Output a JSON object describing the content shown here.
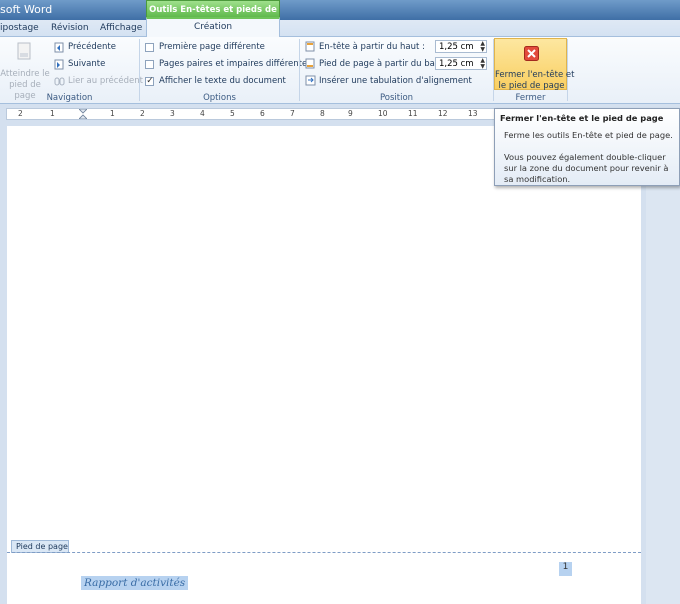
{
  "window": {
    "title": "soft Word"
  },
  "tools_tab": {
    "label": "Outils En-têtes et pieds de page"
  },
  "tabs": [
    {
      "label": "ipostage"
    },
    {
      "label": "Révision"
    },
    {
      "label": "Affichage"
    },
    {
      "label": "Création"
    }
  ],
  "navigation": {
    "goto_label": "Atteindre le pied de page",
    "previous_label": "Précédente",
    "next_label": "Suivante",
    "link_label": "Lier au précédent",
    "group_label": "Navigation"
  },
  "options": {
    "first_page": {
      "label": "Première page différente",
      "checked": false
    },
    "odd_even": {
      "label": "Pages paires et impaires différentes",
      "checked": false
    },
    "show_text": {
      "label": "Afficher le texte du document",
      "checked": true
    },
    "group_label": "Options"
  },
  "position": {
    "header_label": "En-tête à partir du haut :",
    "header_value": "1,25 cm",
    "footer_label": "Pied de page à partir du bas :",
    "footer_value": "1,25 cm",
    "insert_tab_label": "Insérer une tabulation d'alignement",
    "group_label": "Position"
  },
  "close": {
    "label_line1": "Fermer l'en-tête et",
    "label_line2": "le pied de page",
    "group_label": "Fermer"
  },
  "ruler": {
    "numbers": [
      "2",
      "1",
      "1",
      "2",
      "3",
      "4",
      "5",
      "6",
      "7",
      "8",
      "9",
      "10",
      "11",
      "12",
      "13"
    ]
  },
  "document": {
    "footer_tag": "Pied de page",
    "footer_text": "Rapport d'activités",
    "page_number": "1"
  },
  "tooltip": {
    "title": "Fermer l'en-tête et le pied de page",
    "line1": "Ferme les outils En-tête et pied de page.",
    "line2": "Vous pouvez également double-cliquer sur la zone du document pour revenir à sa modification."
  }
}
